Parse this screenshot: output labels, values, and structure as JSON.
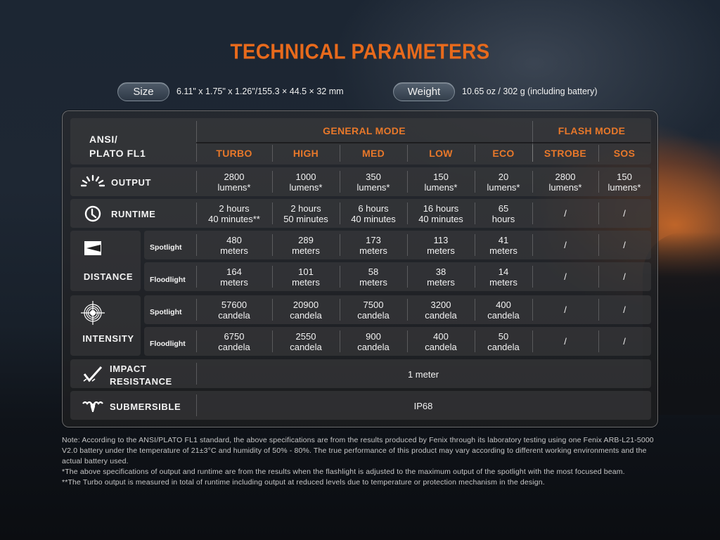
{
  "title": "TECHNICAL PARAMETERS",
  "size": {
    "label": "Size",
    "value": "6.11\" x 1.75\" x 1.26\"/155.3 × 44.5 × 32 mm"
  },
  "weight": {
    "label": "Weight",
    "value": "10.65 oz / 302 g (including battery)"
  },
  "table": {
    "corner_label_line1": "ANSI/",
    "corner_label_line2": "PLATO FL1",
    "group_general": "GENERAL MODE",
    "group_flash": "FLASH MODE",
    "modes": [
      "TURBO",
      "HIGH",
      "MED",
      "LOW",
      "ECO",
      "STROBE",
      "SOS"
    ],
    "rows": {
      "output": {
        "label": "OUTPUT",
        "icon": "light-burst-icon",
        "values": [
          [
            "2800",
            "lumens*"
          ],
          [
            "1000",
            "lumens*"
          ],
          [
            "350",
            "lumens*"
          ],
          [
            "150",
            "lumens*"
          ],
          [
            "20",
            "lumens*"
          ],
          [
            "2800",
            "lumens*"
          ],
          [
            "150",
            "lumens*"
          ]
        ]
      },
      "runtime": {
        "label": "RUNTIME",
        "icon": "clock-icon",
        "values": [
          [
            "2 hours",
            "40 minutes**"
          ],
          [
            "2 hours",
            "50 minutes"
          ],
          [
            "6 hours",
            "40 minutes"
          ],
          [
            "16 hours",
            "40 minutes"
          ],
          [
            "65",
            "hours"
          ],
          [
            "/",
            ""
          ],
          [
            "/",
            ""
          ]
        ]
      },
      "distance": {
        "label": "DISTANCE",
        "icon": "beam-distance-icon",
        "spotlight": {
          "label": "Spotlight",
          "values": [
            [
              "480",
              "meters"
            ],
            [
              "289",
              "meters"
            ],
            [
              "173",
              "meters"
            ],
            [
              "113",
              "meters"
            ],
            [
              "41",
              "meters"
            ],
            [
              "/",
              ""
            ],
            [
              "/",
              ""
            ]
          ]
        },
        "floodlight": {
          "label": "Floodlight",
          "values": [
            [
              "164",
              "meters"
            ],
            [
              "101",
              "meters"
            ],
            [
              "58",
              "meters"
            ],
            [
              "38",
              "meters"
            ],
            [
              "14",
              "meters"
            ],
            [
              "/",
              ""
            ],
            [
              "/",
              ""
            ]
          ]
        }
      },
      "intensity": {
        "label": "INTENSITY",
        "icon": "target-icon",
        "spotlight": {
          "label": "Spotlight",
          "values": [
            [
              "57600",
              "candela"
            ],
            [
              "20900",
              "candela"
            ],
            [
              "7500",
              "candela"
            ],
            [
              "3200",
              "candela"
            ],
            [
              "400",
              "candela"
            ],
            [
              "/",
              ""
            ],
            [
              "/",
              ""
            ]
          ]
        },
        "floodlight": {
          "label": "Floodlight",
          "values": [
            [
              "6750",
              "candela"
            ],
            [
              "2550",
              "candela"
            ],
            [
              "900",
              "candela"
            ],
            [
              "400",
              "candela"
            ],
            [
              "50",
              "candela"
            ],
            [
              "/",
              ""
            ],
            [
              "/",
              ""
            ]
          ]
        }
      },
      "impact": {
        "label_line1": "IMPACT",
        "label_line2": "RESISTANCE",
        "icon": "impact-icon",
        "value": "1 meter"
      },
      "submersible": {
        "label": "SUBMERSIBLE",
        "icon": "water-drop-icon",
        "value": "IP68"
      }
    }
  },
  "notes": [
    "Note:  According to the ANSI/PLATO FL1 standard, the above specifications are from the results produced by Fenix through its laboratory testing using one Fenix ARB-L21-5000 V2.0 battery under the temperature of 21±3°C and humidity of 50% - 80%. The true performance of this product may vary according to different working environments and the actual battery used.",
    "*The above specifications of output and runtime are from the results when the flashlight is adjusted to the maximum output of the spotlight with the most focused beam.",
    "**The Turbo output is measured in total of runtime including output at reduced levels due to temperature or protection mechanism in the design."
  ],
  "colors": {
    "accent": "#e8782a",
    "title": "#e86a1c",
    "text": "#f2f2f2"
  }
}
